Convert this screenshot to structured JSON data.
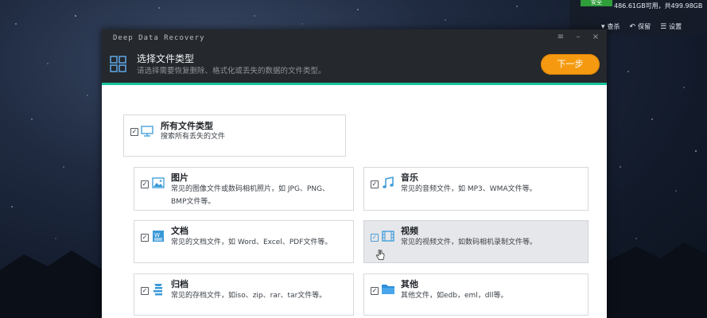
{
  "disk_widget": {
    "safe_badge": "安全",
    "free_text": "486.61GB可用，共499.98GB",
    "actions": [
      {
        "label": "查杀",
        "icon": "pin-icon"
      },
      {
        "label": "保留",
        "icon": "back-icon"
      },
      {
        "label": "设置",
        "icon": "menu-icon"
      }
    ]
  },
  "window": {
    "app_title": "Deep Data Recovery",
    "controls": [
      "≡",
      "–",
      "×"
    ]
  },
  "header": {
    "title": "选择文件类型",
    "subtitle": "请选择需要恢复删除、格式化或丢失的数据的文件类型。",
    "next_button": "下一步",
    "accent_color": "#17c39a",
    "button_color": "#f59a10"
  },
  "file_types": {
    "all": {
      "name": "所有文件类型",
      "desc": "搜索所有丢失的文件",
      "checked": true,
      "icon": "monitor-icon"
    },
    "items": [
      {
        "name": "图片",
        "desc_lines": [
          "常见的图像文件或数码相机照片，如 JPG、PNG、",
          "BMP文件等。"
        ],
        "checked": true,
        "icon": "image-icon"
      },
      {
        "name": "音乐",
        "desc_lines": [
          "常见的音频文件，如 MP3、WMA文件等。"
        ],
        "checked": true,
        "icon": "music-note-icon"
      },
      {
        "name": "文档",
        "desc_lines": [
          "常见的文档文件，如 Word、Excel、PDF文件等。"
        ],
        "checked": true,
        "icon": "word-document-icon"
      },
      {
        "name": "视频",
        "desc_lines": [
          "常见的视频文件，如数码相机录制文件等。"
        ],
        "checked": true,
        "icon": "film-icon",
        "hovered": true
      },
      {
        "name": "归档",
        "desc_lines": [
          "常见的存档文件，如iso、zip、rar、tar文件等。"
        ],
        "checked": true,
        "icon": "archive-icon"
      },
      {
        "name": "其他",
        "desc_lines": [
          "其他文件，如edb，eml，dll等。"
        ],
        "checked": true,
        "icon": "folder-icon"
      }
    ]
  }
}
